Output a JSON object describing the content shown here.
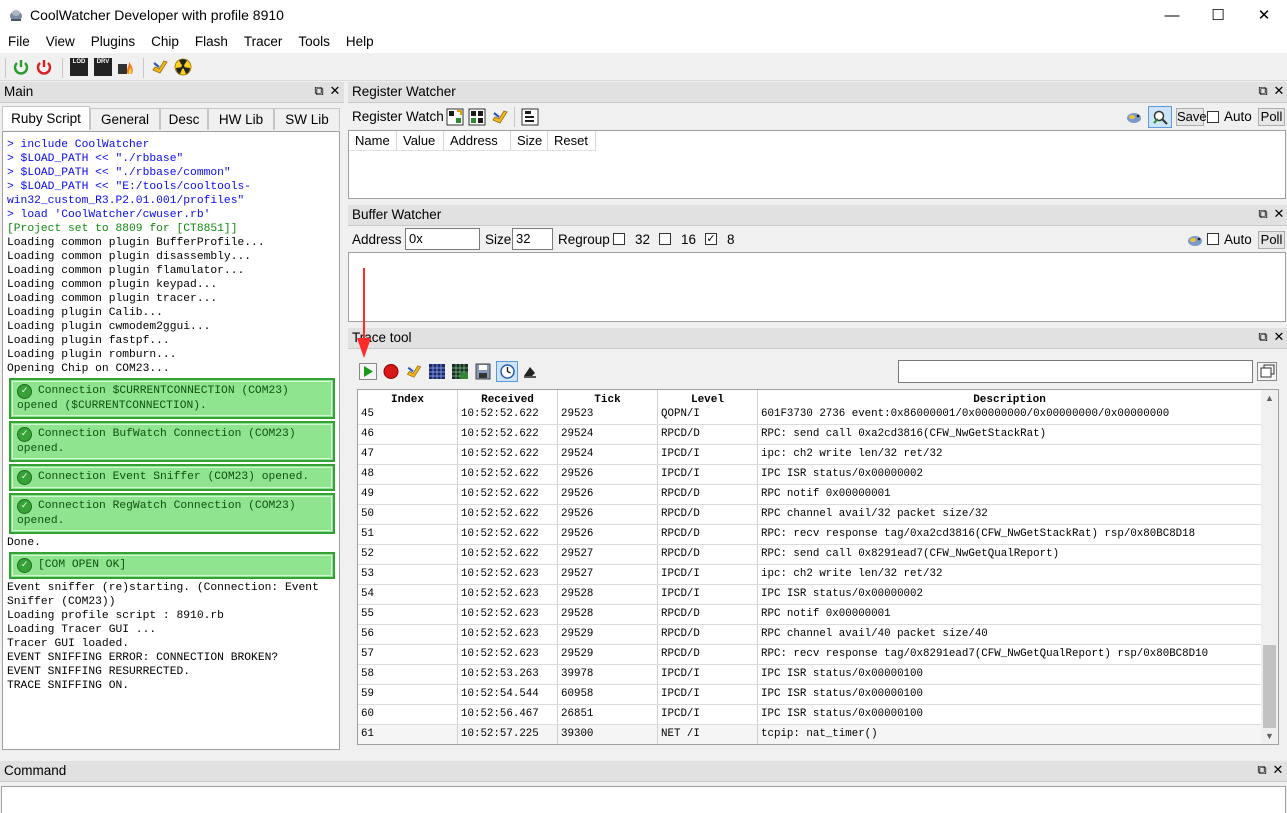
{
  "window": {
    "title": "CoolWatcher Developer with profile 8910",
    "minimize": "—",
    "maximize": "☐",
    "close": "✕"
  },
  "menu": [
    "File",
    "View",
    "Plugins",
    "Chip",
    "Flash",
    "Tracer",
    "Tools",
    "Help"
  ],
  "toolbar": {
    "buttons": [
      "power-on-icon",
      "power-off-icon",
      "load-icon",
      "drv-icon",
      "burn-icon",
      "wrench-icon",
      "radiation-icon"
    ],
    "load_label": "LOD",
    "drv_label": "DRV"
  },
  "main_panel": {
    "title": "Main",
    "tabs": [
      "Ruby Script",
      "General",
      "Desc",
      "HW Lib",
      "SW Lib"
    ],
    "active_tab": "Ruby Script",
    "console": [
      {
        "kind": "cmd",
        "text": "> include CoolWatcher"
      },
      {
        "kind": "cmd",
        "text": "> $LOAD_PATH << \"./rbbase\""
      },
      {
        "kind": "cmd",
        "text": "> $LOAD_PATH << \"./rbbase/common\""
      },
      {
        "kind": "cmd",
        "text": "> $LOAD_PATH << \"E:/tools/cooltools-"
      },
      {
        "kind": "cmd",
        "text": "win32_custom_R3.P2.01.001/profiles\""
      },
      {
        "kind": "cmd",
        "text": "> load 'CoolWatcher/cwuser.rb'"
      },
      {
        "kind": "green",
        "text": "[Project set to 8809 for [CT8851]]"
      },
      {
        "kind": "text",
        "text": "Loading common plugin BufferProfile..."
      },
      {
        "kind": "text",
        "text": "Loading common plugin disassembly..."
      },
      {
        "kind": "text",
        "text": "Loading common plugin flamulator..."
      },
      {
        "kind": "text",
        "text": "Loading common plugin keypad..."
      },
      {
        "kind": "text",
        "text": "Loading common plugin tracer..."
      },
      {
        "kind": "text",
        "text": "Loading plugin Calib..."
      },
      {
        "kind": "text",
        "text": "Loading plugin cwmodem2ggui..."
      },
      {
        "kind": "text",
        "text": "Loading plugin fastpf..."
      },
      {
        "kind": "text",
        "text": "Loading plugin romburn..."
      },
      {
        "kind": "text",
        "text": "Opening Chip on COM23..."
      },
      {
        "kind": "box",
        "text": "Connection $CURRENTCONNECTION (COM23)\nopened ($CURRENTCONNECTION)."
      },
      {
        "kind": "box",
        "text": "Connection BufWatch Connection (COM23)\nopened."
      },
      {
        "kind": "box",
        "text": "Connection Event Sniffer (COM23) opened."
      },
      {
        "kind": "box",
        "text": "Connection RegWatch Connection (COM23)\nopened."
      },
      {
        "kind": "text",
        "text": "Done."
      },
      {
        "kind": "box",
        "text": "[COM OPEN OK]"
      },
      {
        "kind": "text",
        "text": "Event sniffer (re)starting. (Connection: Event"
      },
      {
        "kind": "text",
        "text": "Sniffer (COM23))"
      },
      {
        "kind": "text",
        "text": "Loading profile script : 8910.rb"
      },
      {
        "kind": "text",
        "text": "Loading Tracer GUI ..."
      },
      {
        "kind": "text",
        "text": "Tracer GUI loaded."
      },
      {
        "kind": "text",
        "text": "EVENT SNIFFING ERROR: CONNECTION BROKEN?"
      },
      {
        "kind": "text",
        "text": "EVENT SNIFFING RESURRECTED."
      },
      {
        "kind": "text",
        "text": "TRACE SNIFFING ON."
      }
    ]
  },
  "register_watcher": {
    "title": "Register Watcher",
    "label": "Register Watch",
    "save_label": "Save",
    "auto_label": "Auto",
    "poll_label": "Poll",
    "columns": [
      "Name",
      "Value",
      "Address",
      "Size",
      "Reset"
    ]
  },
  "buffer_watcher": {
    "title": "Buffer Watcher",
    "address_label": "Address",
    "address_value": "0x",
    "size_label": "Size",
    "size_value": "32",
    "regroup_label": "Regroup",
    "regroup_options": [
      {
        "label": "32",
        "checked": false
      },
      {
        "label": "16",
        "checked": false
      },
      {
        "label": "8",
        "checked": true
      }
    ],
    "auto_label": "Auto",
    "poll_label": "Poll"
  },
  "trace_tool": {
    "title": "Trace tool",
    "filter_value": "",
    "columns": [
      "Index",
      "Received",
      "Tick",
      "Level",
      "Description"
    ],
    "rows": [
      [
        "45",
        "10:52:52.622",
        "29523",
        "QOPN/I",
        "601F3730 2736 event:0x86000001/0x00000000/0x00000000/0x00000000"
      ],
      [
        "46",
        "10:52:52.622",
        "29524",
        "RPCD/D",
        "RPC: send call 0xa2cd3816(CFW_NwGetStackRat)"
      ],
      [
        "47",
        "10:52:52.622",
        "29524",
        "IPCD/I",
        "ipc: ch2 write len/32 ret/32"
      ],
      [
        "48",
        "10:52:52.622",
        "29526",
        "IPCD/I",
        "IPC ISR status/0x00000002"
      ],
      [
        "49",
        "10:52:52.622",
        "29526",
        "RPCD/D",
        "RPC notif 0x00000001"
      ],
      [
        "50",
        "10:52:52.622",
        "29526",
        "RPCD/D",
        "RPC channel avail/32 packet size/32"
      ],
      [
        "51",
        "10:52:52.622",
        "29526",
        "RPCD/D",
        "RPC: recv response tag/0xa2cd3816(CFW_NwGetStackRat) rsp/0x80BC8D18"
      ],
      [
        "52",
        "10:52:52.622",
        "29527",
        "RPCD/D",
        "RPC: send call 0x8291ead7(CFW_NwGetQualReport)"
      ],
      [
        "53",
        "10:52:52.623",
        "29527",
        "IPCD/I",
        "ipc: ch2 write len/32 ret/32"
      ],
      [
        "54",
        "10:52:52.623",
        "29528",
        "IPCD/I",
        "IPC ISR status/0x00000002"
      ],
      [
        "55",
        "10:52:52.623",
        "29528",
        "RPCD/D",
        "RPC notif 0x00000001"
      ],
      [
        "56",
        "10:52:52.623",
        "29529",
        "RPCD/D",
        "RPC channel avail/40 packet size/40"
      ],
      [
        "57",
        "10:52:52.623",
        "29529",
        "RPCD/D",
        "RPC: recv response tag/0x8291ead7(CFW_NwGetQualReport) rsp/0x80BC8D10"
      ],
      [
        "58",
        "10:52:53.263",
        "39978",
        "IPCD/I",
        "IPC ISR status/0x00000100"
      ],
      [
        "59",
        "10:52:54.544",
        "60958",
        "IPCD/I",
        "IPC ISR status/0x00000100"
      ],
      [
        "60",
        "10:52:56.467",
        "26851",
        "IPCD/I",
        "IPC ISR status/0x00000100"
      ],
      [
        "61",
        "10:52:57.225",
        "39300",
        "NET /I",
        "tcpip: nat_timer()"
      ]
    ],
    "selected_row": "61"
  },
  "command_panel": {
    "title": "Command"
  },
  "colors": {
    "annotation_arrow": "#ff2a2a",
    "console_blue": "#0a0af0",
    "console_green": "#118811",
    "box_green": "#8fe58f"
  }
}
